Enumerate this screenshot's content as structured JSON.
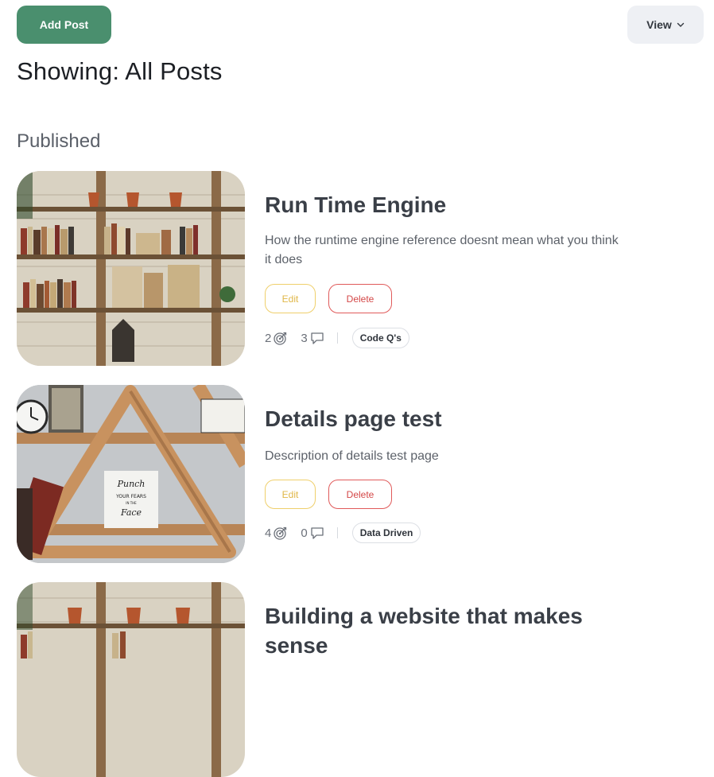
{
  "toolbar": {
    "add_label": "Add Post",
    "view_label": "View"
  },
  "page_title": "Showing: All Posts",
  "section_title": "Published",
  "posts": [
    {
      "title": "Run Time Engine",
      "description": "How the runtime engine reference doesnt mean what you think it does",
      "edit_label": "Edit",
      "delete_label": "Delete",
      "target_count": "2",
      "comment_count": "3",
      "tag": "Code Q's"
    },
    {
      "title": "Details page test",
      "description": "Description of details test page",
      "edit_label": "Edit",
      "delete_label": "Delete",
      "target_count": "4",
      "comment_count": "0",
      "tag": "Data Driven"
    },
    {
      "title": "Building a website that makes sense"
    }
  ],
  "icons": {
    "target": "target-icon",
    "comment": "comment-icon",
    "chevron": "chevron-down-icon"
  },
  "colors": {
    "primary": "#4a8f6e",
    "edit": "#e0b748",
    "delete": "#d44747"
  }
}
